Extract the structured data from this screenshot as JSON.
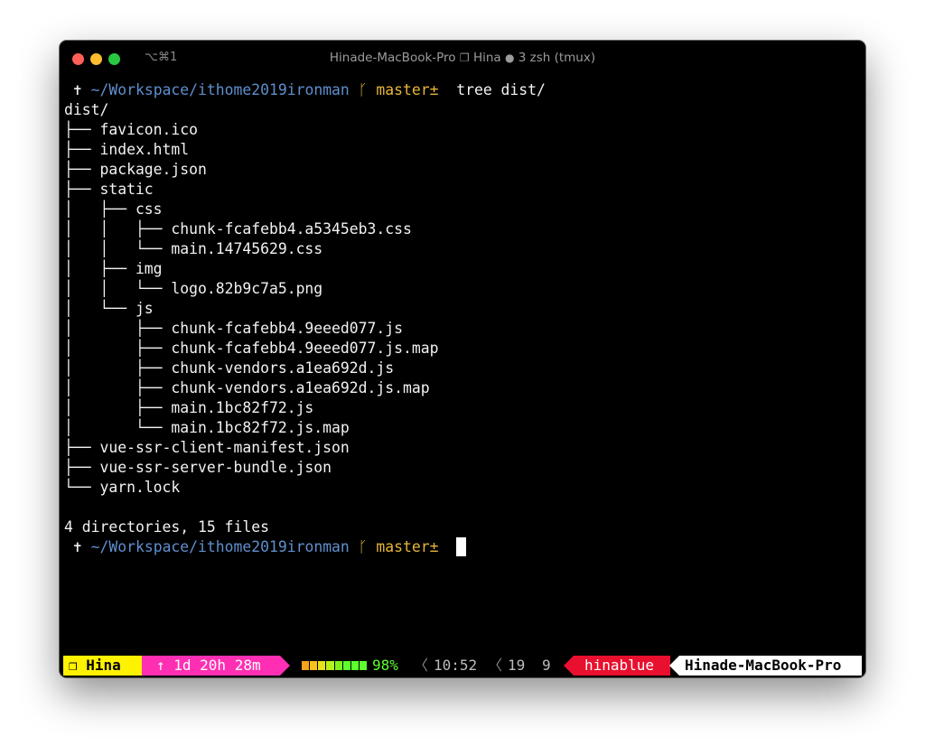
{
  "window": {
    "shortcut": "⌥⌘1",
    "title_parts": {
      "host": "Hinade-MacBook-Pro",
      "session_icon": "window-icon",
      "session": "Hina",
      "pane_icon": "circle-icon",
      "pane": "3 zsh (tmux)"
    }
  },
  "prompt1": {
    "symbol": "✝",
    "path": "~/Workspace/ithome2019ironman",
    "git_icon": "branch-icon",
    "git_glyph": "ᚴ",
    "branch": "master±",
    "command": "tree dist/"
  },
  "tree_lines": [
    "dist/",
    "├── favicon.ico",
    "├── index.html",
    "├── package.json",
    "├── static",
    "│   ├── css",
    "│   │   ├── chunk-fcafebb4.a5345eb3.css",
    "│   │   └── main.14745629.css",
    "│   ├── img",
    "│   │   └── logo.82b9c7a5.png",
    "│   └── js",
    "│       ├── chunk-fcafebb4.9eeed077.js",
    "│       ├── chunk-fcafebb4.9eeed077.js.map",
    "│       ├── chunk-vendors.a1ea692d.js",
    "│       ├── chunk-vendors.a1ea692d.js.map",
    "│       ├── main.1bc82f72.js",
    "│       └── main.1bc82f72.js.map",
    "├── vue-ssr-client-manifest.json",
    "├── vue-ssr-server-bundle.json",
    "└── yarn.lock",
    "",
    "4 directories, 15 files"
  ],
  "prompt2": {
    "symbol": "✝",
    "path": "~/Workspace/ithome2019ironman",
    "git_glyph": "ᚴ",
    "branch": "master±"
  },
  "statusbar": {
    "session_label": "❐ Hina",
    "uptime": "↑ 1d 20h 28m",
    "battery_percent": 98,
    "battery_text": "98%",
    "battery_colors": [
      "#f7a21b",
      "#f7c21b",
      "#e6e21b",
      "#b7f01b",
      "#7ff21b",
      "#5dff2e",
      "#5dff2e",
      "#5dff2e"
    ],
    "separator": "〈",
    "time": "10:52",
    "window_a": "19",
    "window_b": "9",
    "username": "hinablue",
    "hostname": "Hinade-MacBook-Pro"
  }
}
